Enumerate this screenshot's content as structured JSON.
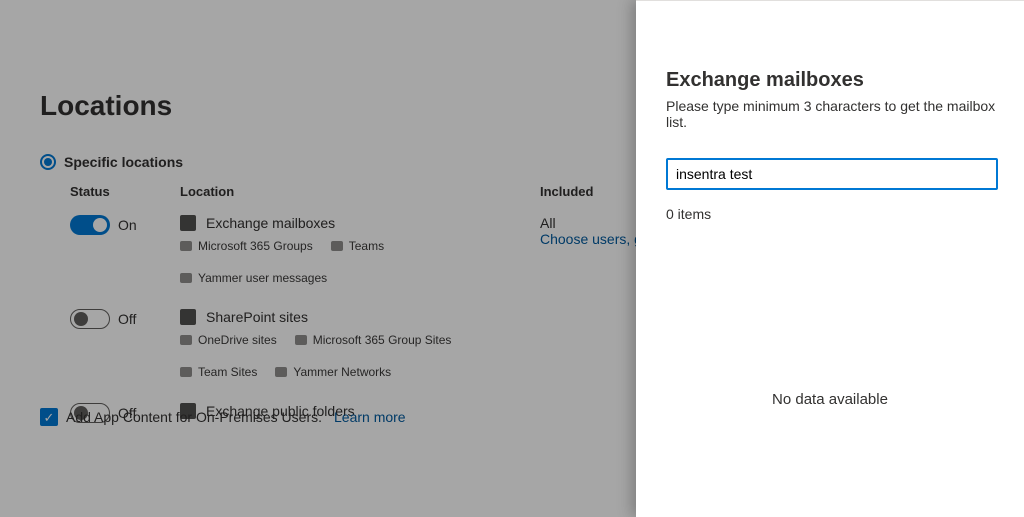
{
  "main": {
    "title": "Locations",
    "radio_label": "Specific locations",
    "columns": {
      "status": "Status",
      "location": "Location",
      "included": "Included"
    },
    "rows": [
      {
        "status_on": true,
        "status_text": "On",
        "name": "Exchange mailboxes",
        "included_value": "All",
        "included_link": "Choose users, gro",
        "subs": [
          "Microsoft 365 Groups",
          "Teams",
          "Yammer user messages"
        ]
      },
      {
        "status_on": false,
        "status_text": "Off",
        "name": "SharePoint sites",
        "included_value": "",
        "included_link": "",
        "subs": [
          "OneDrive sites",
          "Microsoft 365 Group Sites",
          "Team Sites",
          "Yammer Networks"
        ]
      },
      {
        "status_on": false,
        "status_text": "Off",
        "name": "Exchange public folders",
        "included_value": "",
        "included_link": "",
        "subs": []
      }
    ],
    "checkbox_label": "Add App Content for On-Premises Users.",
    "learn_more": "Learn more"
  },
  "panel": {
    "title": "Exchange mailboxes",
    "subtitle": "Please type minimum 3 characters to get the mailbox list.",
    "search_value": "insentra test",
    "items_count": "0 items",
    "no_data": "No data available"
  }
}
